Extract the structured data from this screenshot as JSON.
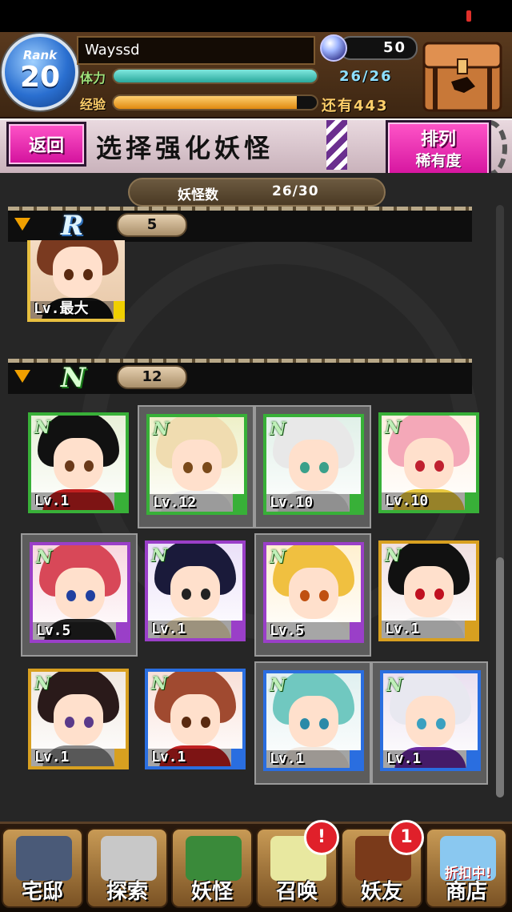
{
  "header": {
    "rank_label": "Rank",
    "rank_value": "20",
    "player_name": "Wayssd",
    "gems": "50",
    "stamina_label": "体力",
    "stamina_value": "26/26",
    "stamina_fraction": 1.0,
    "exp_label": "经验",
    "exp_remaining": "还有443",
    "exp_fraction": 0.9
  },
  "titlebar": {
    "back_label": "返回",
    "title": "选择强化妖怪",
    "sort_label": "排列",
    "sort_value": "稀有度"
  },
  "monster_count": {
    "label": "妖怪数",
    "value": "26/30"
  },
  "sections": [
    {
      "rarity": "R",
      "count": "5"
    },
    {
      "rarity": "N",
      "count": "12"
    }
  ],
  "r_cards": [
    {
      "level": "Lv.最大",
      "frame": "gold",
      "badge": ""
    }
  ],
  "n_cards": [
    {
      "badge": "N",
      "level": "Lv.1",
      "frame": "green",
      "selected": false
    },
    {
      "badge": "N",
      "level": "Lv.12",
      "frame": "green",
      "selected": true
    },
    {
      "badge": "N",
      "level": "Lv.10",
      "frame": "green",
      "selected": true
    },
    {
      "badge": "N",
      "level": "Lv.10",
      "frame": "green",
      "selected": false
    },
    {
      "badge": "N",
      "level": "Lv.5",
      "frame": "purple",
      "selected": true
    },
    {
      "badge": "N",
      "level": "Lv.1",
      "frame": "purple",
      "selected": false
    },
    {
      "badge": "N",
      "level": "Lv.5",
      "frame": "purple",
      "selected": true
    },
    {
      "badge": "N",
      "level": "Lv.1",
      "frame": "gold",
      "selected": false
    },
    {
      "badge": "N",
      "level": "Lv.1",
      "frame": "gold",
      "selected": false
    },
    {
      "badge": "N",
      "level": "Lv.1",
      "frame": "blue",
      "selected": false
    },
    {
      "badge": "N",
      "level": "Lv.1",
      "frame": "blue",
      "selected": true
    },
    {
      "badge": "N",
      "level": "Lv.1",
      "frame": "blue",
      "selected": true
    }
  ],
  "nav": [
    {
      "label": "宅邸",
      "icon": "mansion-icon"
    },
    {
      "label": "探索",
      "icon": "magnifier-icon"
    },
    {
      "label": "妖怪",
      "icon": "scroll-icon"
    },
    {
      "label": "召唤",
      "icon": "star-icon",
      "alert": "!"
    },
    {
      "label": "妖友",
      "icon": "friend-icon",
      "alert": "1"
    },
    {
      "label": "商店",
      "icon": "shop-orb-icon",
      "badge": "折扣中!"
    }
  ],
  "colors": {
    "stamina_bar": "#3fc0b8",
    "exp_bar": "#f0a020",
    "button_pink": "#e02aa8",
    "frame_green": "#38b038",
    "frame_purple": "#9a3fc8",
    "frame_gold": "#d8a020",
    "frame_blue": "#2a6ee0"
  }
}
